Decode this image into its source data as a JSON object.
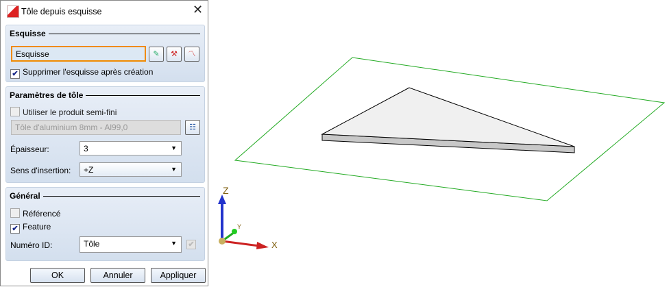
{
  "dialog": {
    "title": "Tôle depuis esquisse"
  },
  "sketch": {
    "header": "Esquisse",
    "field_value": "Esquisse",
    "delete_label": "Supprimer l'esquisse après création",
    "delete_checked": true
  },
  "sheet": {
    "header": "Paramètres de tôle",
    "semi_label": "Utiliser le produit semi-fini",
    "semi_checked": false,
    "material": "Tôle d'aluminium 8mm - Al99,0",
    "thickness_label": "Épaisseur:",
    "thickness": "3",
    "direction_label": "Sens d'insertion:",
    "direction": "+Z"
  },
  "general": {
    "header": "Général",
    "ref_label": "Référencé",
    "ref_checked": false,
    "feature_label": "Feature",
    "feature_checked": true,
    "id_label": "Numéro ID:",
    "id_value": "Tôle"
  },
  "buttons": {
    "ok": "OK",
    "cancel": "Annuler",
    "apply": "Appliquer"
  },
  "axes": {
    "x": "X",
    "y": "Y",
    "z": "Z"
  },
  "colors": {
    "plane": "#22aa22",
    "x_axis": "#cc2222",
    "y_axis": "#22aa22",
    "z_axis": "#2233cc",
    "focus": "#f08a00"
  }
}
